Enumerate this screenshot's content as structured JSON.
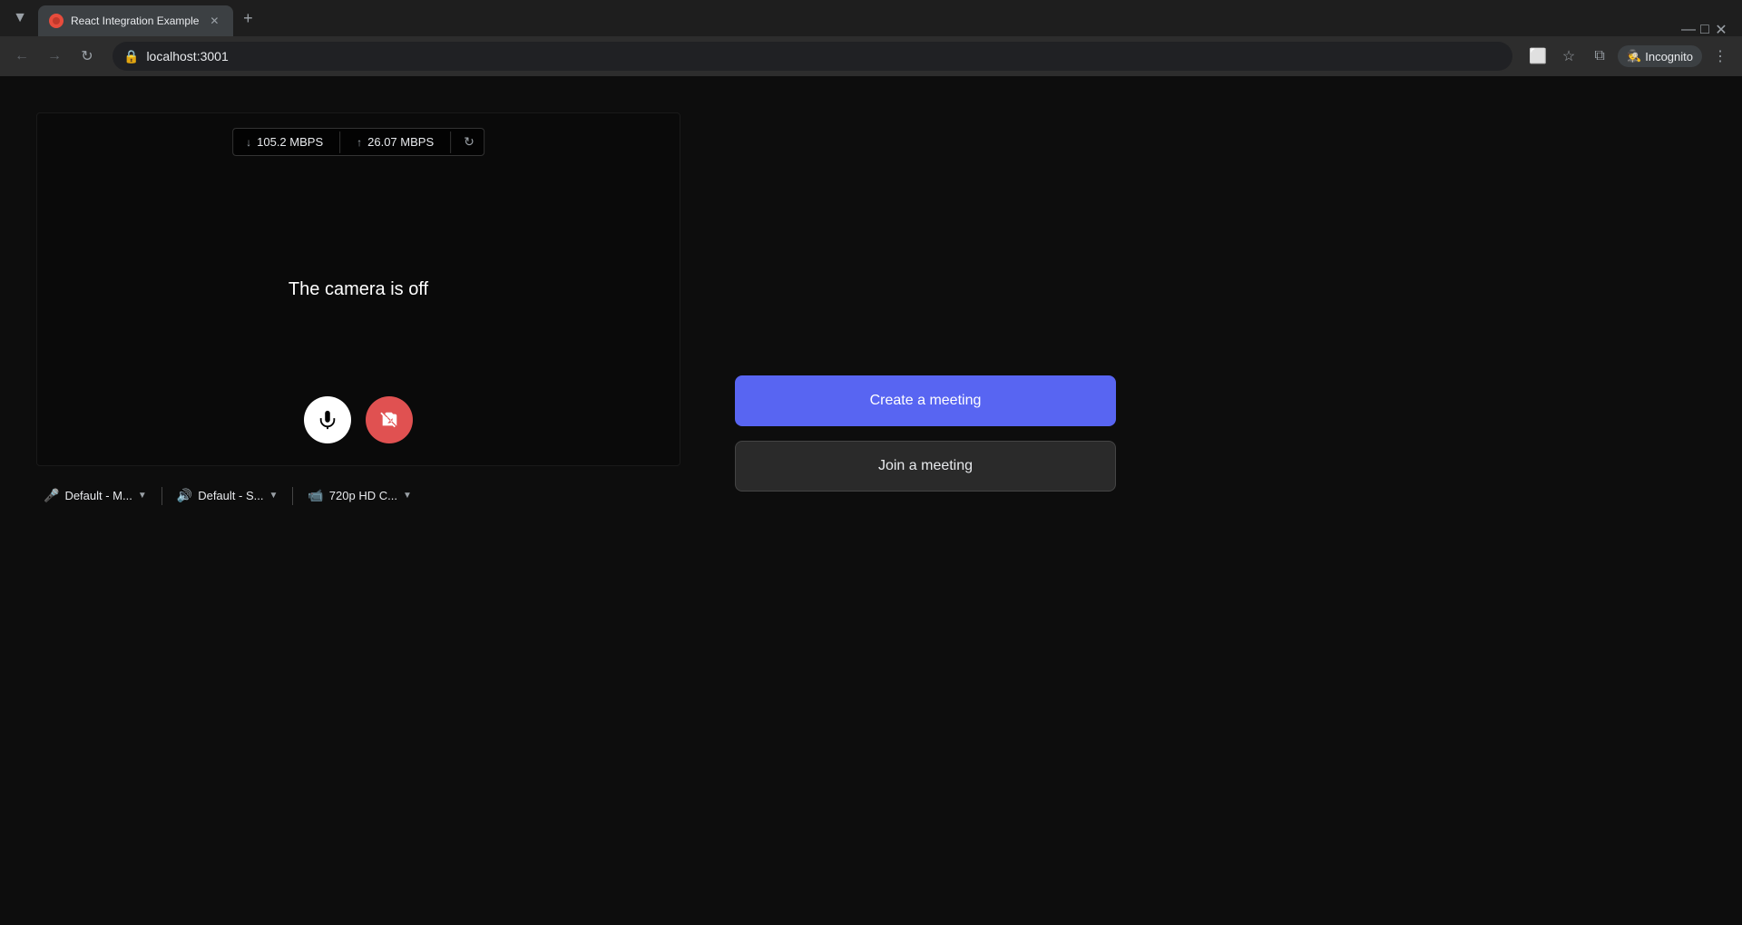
{
  "browser": {
    "tab": {
      "title": "React Integration Example",
      "favicon_color": "#e74c3c"
    },
    "new_tab_label": "+",
    "address": "localhost:3001",
    "incognito_label": "Incognito",
    "nav": {
      "back_icon": "←",
      "forward_icon": "→",
      "refresh_icon": "↻"
    },
    "window_controls": {
      "minimize": "—",
      "maximize": "□",
      "close": "✕"
    }
  },
  "page": {
    "stats": {
      "download_speed": "105.2 MBPS",
      "upload_speed": "26.07 MBPS",
      "download_icon": "↓",
      "upload_icon": "↑"
    },
    "camera_off_text": "The camera is off",
    "controls": {
      "mic_icon": "🎤",
      "camera_off_icon": "📷"
    },
    "devices": {
      "mic_label": "Default - M...",
      "mic_icon": "🎤",
      "speaker_label": "Default - S...",
      "speaker_icon": "🔊",
      "camera_label": "720p HD C...",
      "camera_icon": "📹"
    },
    "meeting": {
      "create_label": "Create a meeting",
      "join_label": "Join a meeting"
    }
  }
}
